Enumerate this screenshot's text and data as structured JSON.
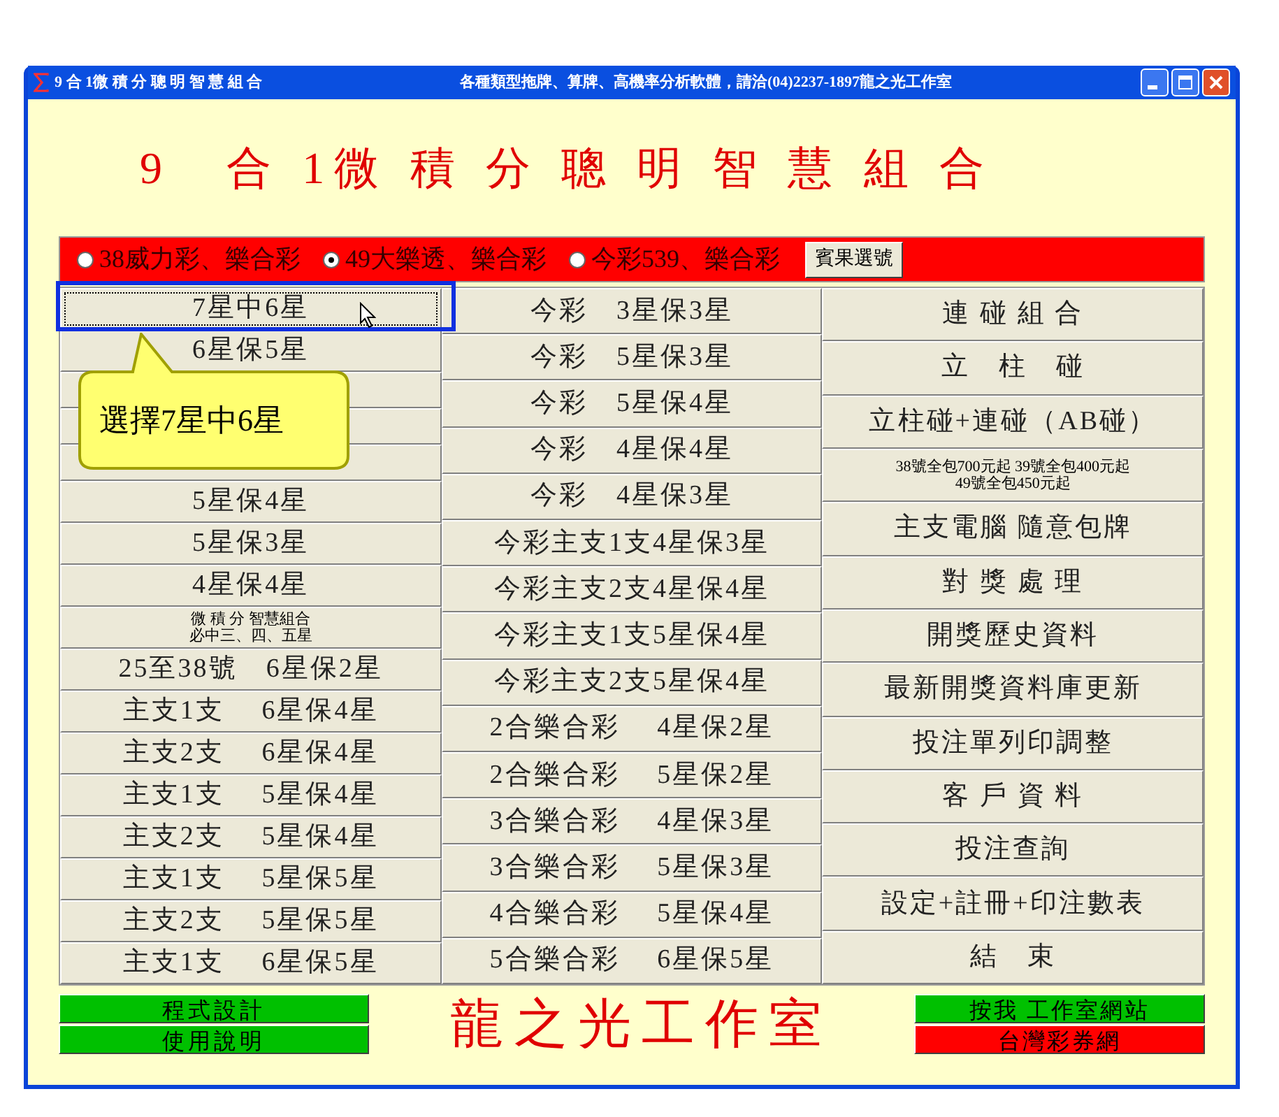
{
  "window": {
    "title": "9 合 1微 積 分 聰 明 智 慧 組 合",
    "subtitle": "各種類型拖牌、算牌、高機率分析軟體，請洽(04)2237-1897龍之光工作室"
  },
  "heading": "9　合 1微 積 分 聰 明 智 慧 組 合",
  "radios": [
    {
      "label": "38威力彩、樂合彩",
      "selected": false
    },
    {
      "label": "49大樂透、樂合彩",
      "selected": true
    },
    {
      "label": "今彩539、樂合彩",
      "selected": false
    }
  ],
  "bingo_button": "賓果選號",
  "columns": [
    {
      "buttons": [
        {
          "kind": "normal",
          "label": "7星中6星",
          "focused": true
        },
        {
          "kind": "normal",
          "label": "6星保5星",
          "focused": false
        },
        {
          "kind": "blank"
        },
        {
          "kind": "blank"
        },
        {
          "kind": "blank"
        },
        {
          "kind": "normal",
          "label": "5星保4星",
          "focused": false
        },
        {
          "kind": "normal",
          "label": "5星保3星",
          "focused": false
        },
        {
          "kind": "normal",
          "label": "4星保4星",
          "focused": false
        },
        {
          "kind": "small",
          "label": "微 積 分 智慧組合",
          "label2": "必中三、四、五星",
          "focused": false
        },
        {
          "kind": "normal",
          "label": "25至38號　6星保2星",
          "focused": false
        },
        {
          "kind": "normal",
          "label": "主支1支　 6星保4星",
          "focused": false
        },
        {
          "kind": "normal",
          "label": "主支2支　 6星保4星",
          "focused": false
        },
        {
          "kind": "normal",
          "label": "主支1支　 5星保4星",
          "focused": false
        },
        {
          "kind": "normal",
          "label": "主支2支　 5星保4星",
          "focused": false
        },
        {
          "kind": "normal",
          "label": "主支1支　 5星保5星",
          "focused": false
        },
        {
          "kind": "normal",
          "label": "主支2支　 5星保5星",
          "focused": false
        },
        {
          "kind": "normal",
          "label": "主支1支　 6星保5星",
          "focused": false
        }
      ]
    },
    {
      "buttons": [
        {
          "kind": "normal",
          "label": "今彩　3星保3星",
          "focused": false
        },
        {
          "kind": "normal",
          "label": "今彩　5星保3星",
          "focused": false
        },
        {
          "kind": "normal",
          "label": "今彩　5星保4星",
          "focused": false
        },
        {
          "kind": "normal",
          "label": "今彩　4星保4星",
          "focused": false
        },
        {
          "kind": "normal",
          "label": "今彩　4星保3星",
          "focused": false
        },
        {
          "kind": "normal",
          "label": "今彩主支1支4星保3星",
          "focused": false
        },
        {
          "kind": "normal",
          "label": "今彩主支2支4星保4星",
          "focused": false
        },
        {
          "kind": "normal",
          "label": "今彩主支1支5星保4星",
          "focused": false
        },
        {
          "kind": "normal",
          "label": "今彩主支2支5星保4星",
          "focused": false
        },
        {
          "kind": "normal",
          "label": "2合樂合彩　 4星保2星",
          "focused": false
        },
        {
          "kind": "normal",
          "label": "2合樂合彩　 5星保2星",
          "focused": false
        },
        {
          "kind": "normal",
          "label": "3合樂合彩　 4星保3星",
          "focused": false
        },
        {
          "kind": "normal",
          "label": "3合樂合彩　 5星保3星",
          "focused": false
        },
        {
          "kind": "normal",
          "label": "4合樂合彩　 5星保4星",
          "focused": false
        },
        {
          "kind": "normal",
          "label": "5合樂合彩　 6星保5星",
          "focused": false
        }
      ]
    },
    {
      "buttons": [
        {
          "kind": "normal",
          "label": "連 碰 組 合",
          "focused": false
        },
        {
          "kind": "normal",
          "label": "立　柱　碰",
          "focused": false
        },
        {
          "kind": "normal",
          "label": "立柱碰+連碰（AB碰）",
          "focused": false
        },
        {
          "kind": "small",
          "label": "38號全包700元起 39號全包400元起",
          "label2": "49號全包450元起",
          "focused": false
        },
        {
          "kind": "normal",
          "label": "主支電腦 隨意包牌",
          "focused": false
        },
        {
          "kind": "normal",
          "label": "對 獎 處 理",
          "focused": false
        },
        {
          "kind": "normal",
          "label": "開獎歷史資料",
          "focused": false
        },
        {
          "kind": "normal",
          "label": "最新開獎資料庫更新",
          "focused": false
        },
        {
          "kind": "normal",
          "label": "投注單列印調整",
          "focused": false
        },
        {
          "kind": "normal",
          "label": "客 戶 資 料",
          "focused": false
        },
        {
          "kind": "normal",
          "label": "投注查詢",
          "focused": false
        },
        {
          "kind": "normal",
          "label": "設定+註冊+印注數表",
          "focused": false
        },
        {
          "kind": "normal",
          "label": "結　束",
          "focused": false
        }
      ]
    }
  ],
  "callout": "選擇7星中6星",
  "footer_left": [
    {
      "label": "程式設計",
      "color": "#00c000"
    },
    {
      "label": "使用說明",
      "color": "#00c000"
    }
  ],
  "studio": "龍之光工作室",
  "footer_right": [
    {
      "label": "按我 工作室網站",
      "color": "#00c000"
    },
    {
      "label": "台灣彩券網",
      "color": "#ff0000"
    }
  ]
}
